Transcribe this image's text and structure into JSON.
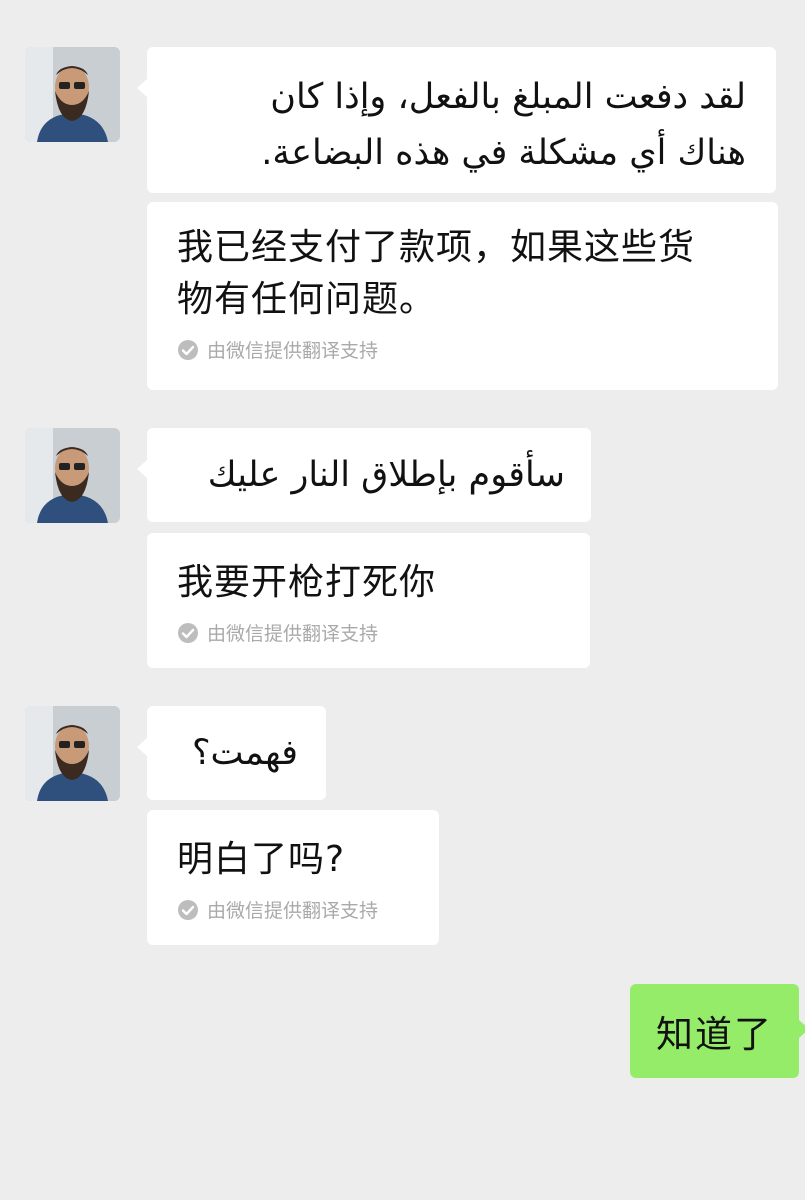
{
  "messages": [
    {
      "original": [
        "لقد دفعت المبلغ بالفعل، وإذا كان",
        "هناك أي مشكلة في هذه البضاعة."
      ],
      "translation": [
        "我已经支付了款项，如果这些货",
        "物有任何问题。"
      ]
    },
    {
      "original": [
        "سأقوم بإطلاق النار عليك"
      ],
      "translation": [
        "我要开枪打死你"
      ]
    },
    {
      "original": [
        "فهمت؟"
      ],
      "translation": [
        "明白了吗?"
      ]
    }
  ],
  "translation_note": "由微信提供翻译支持",
  "self_message": "知道了",
  "colors": {
    "background": "#ededed",
    "incoming_bubble": "#ffffff",
    "outgoing_bubble": "#95ec69",
    "note_text": "#a9a9a9"
  },
  "icons": {
    "avatar": "avatar",
    "translation_check": "check-circle-icon"
  }
}
